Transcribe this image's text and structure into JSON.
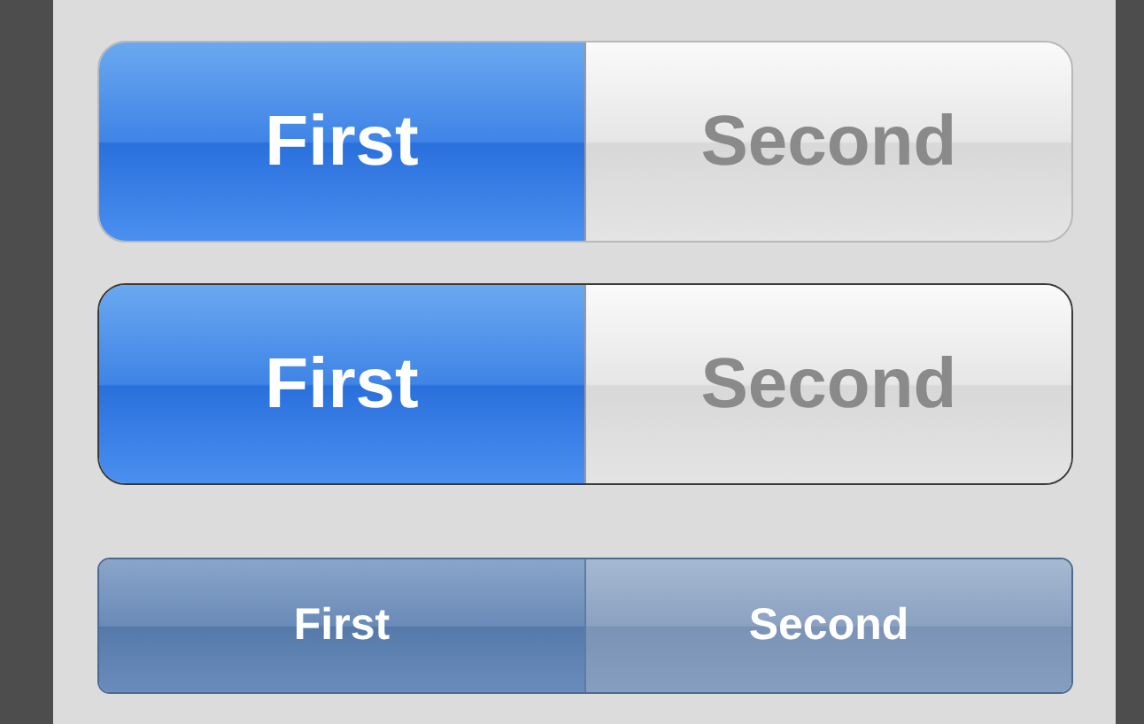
{
  "segmented_controls": [
    {
      "kind": "plain",
      "segments": [
        {
          "label": "First",
          "selected": true
        },
        {
          "label": "Second",
          "selected": false
        }
      ]
    },
    {
      "kind": "bordered",
      "segments": [
        {
          "label": "First",
          "selected": true
        },
        {
          "label": "Second",
          "selected": false
        }
      ]
    },
    {
      "kind": "bar",
      "segments": [
        {
          "label": "First",
          "selected": true
        },
        {
          "label": "Second",
          "selected": false
        }
      ]
    }
  ]
}
